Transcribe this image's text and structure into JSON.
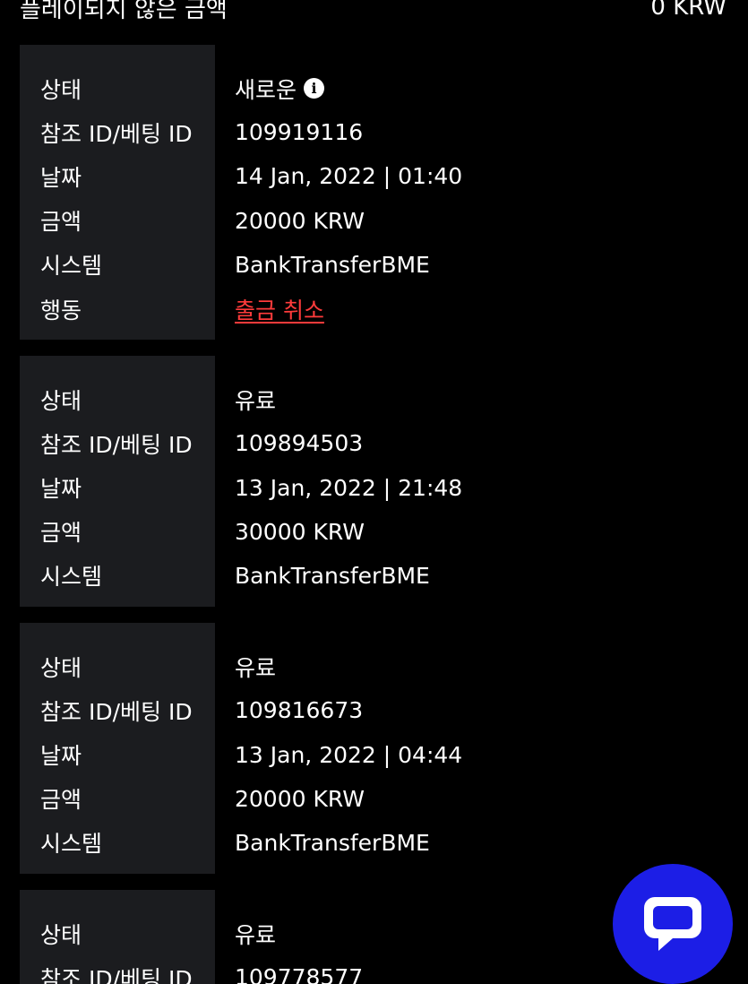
{
  "header": {
    "unplayed_label": "플레이되지 않은 금액",
    "unplayed_value": "0 KRW"
  },
  "labels": {
    "status": "상태",
    "ref_id": "참조 ID/베팅 ID",
    "date": "날짜",
    "amount": "금액",
    "system": "시스템",
    "action": "행동"
  },
  "records": [
    {
      "status": "새로운",
      "ref_id": "109919116",
      "date": "14 Jan, 2022 | 01:40",
      "amount": "20000 KRW",
      "system": "BankTransferBME",
      "action": "출금 취소"
    },
    {
      "status": "유료",
      "ref_id": "109894503",
      "date": "13 Jan, 2022 | 21:48",
      "amount": "30000 KRW",
      "system": "BankTransferBME"
    },
    {
      "status": "유료",
      "ref_id": "109816673",
      "date": "13 Jan, 2022 | 04:44",
      "amount": "20000 KRW",
      "system": "BankTransferBME"
    },
    {
      "status": "유료",
      "ref_id": "109778577"
    }
  ],
  "icons": {
    "info": "info-circle-icon",
    "chat": "chat-bubble-icon"
  },
  "colors": {
    "background": "#000000",
    "label_panel": "#1b1c1f",
    "link_red": "#ff3b3b",
    "chat_blue": "#1c1ee6"
  }
}
